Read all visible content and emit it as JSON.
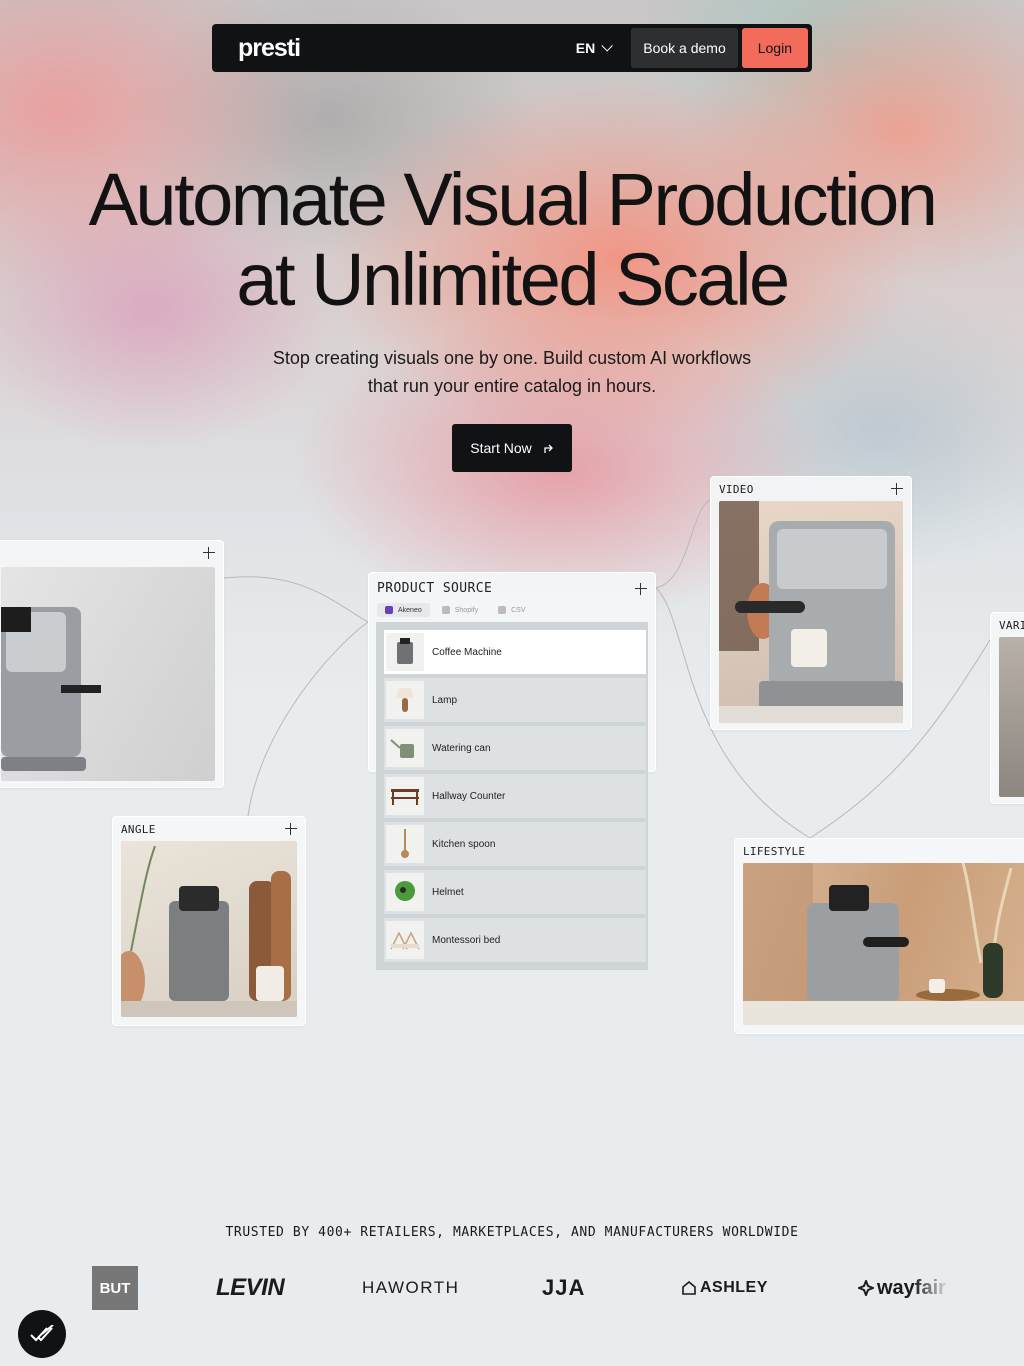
{
  "nav": {
    "logo": "presti",
    "language": "EN",
    "book_demo": "Book a demo",
    "login": "Login"
  },
  "hero": {
    "title_line1": "Automate Visual Production",
    "title_line2": "at Unlimited Scale",
    "subtitle_line1": "Stop creating visuals one by one. Build custom AI workflows",
    "subtitle_line2": "that run your entire catalog in hours.",
    "cta": "Start Now"
  },
  "workflow": {
    "angle_label": "ANGLE",
    "video_label": "VIDEO",
    "lifestyle_label": "LIFESTYLE",
    "variant_label": "VARI",
    "product_source": {
      "label": "PRODUCT SOURCE",
      "tabs": [
        "Akeneo",
        "Shopify",
        "CSV"
      ],
      "items": [
        "Coffee Machine",
        "Lamp",
        "Watering can",
        "Hallway Counter",
        "Kitchen spoon",
        "Helmet",
        "Montessori bed"
      ]
    }
  },
  "trust": {
    "headline": "TRUSTED BY 400+ RETAILERS, MARKETPLACES, AND MANUFACTURERS WORLDWIDE",
    "logos": [
      "BUT",
      "LEVIN",
      "HAWORTH",
      "JJA",
      "ASHLEY",
      "wayfair"
    ]
  },
  "colors": {
    "accent": "#f26b5b",
    "dark": "#111214"
  },
  "icons": [
    "chevron-down-icon",
    "arrow-up-right-icon",
    "plus-icon",
    "check-badge-icon"
  ]
}
